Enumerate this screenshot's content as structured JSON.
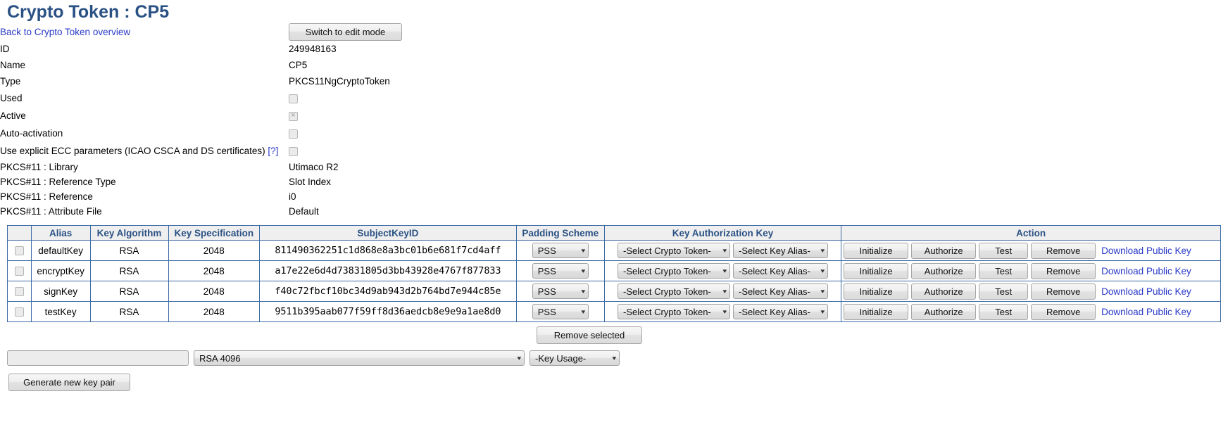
{
  "header": {
    "title": "Crypto Token : CP5",
    "back_link": "Back to Crypto Token overview",
    "switch_button": "Switch to edit mode"
  },
  "details": [
    {
      "label": "ID",
      "value": "249948163",
      "type": "text"
    },
    {
      "label": "Name",
      "value": "CP5",
      "type": "text"
    },
    {
      "label": "Type",
      "value": "PKCS11NgCryptoToken",
      "type": "text"
    },
    {
      "label": "Used",
      "value": "",
      "type": "checkbox",
      "checked": false
    },
    {
      "label": "Active",
      "value": "",
      "type": "checkbox",
      "checked": true
    },
    {
      "label": "Auto-activation",
      "value": "",
      "type": "checkbox",
      "checked": false
    },
    {
      "label": "Use explicit ECC parameters (ICAO CSCA and DS certificates)",
      "value": "",
      "type": "checkbox",
      "checked": false,
      "help": "[?]"
    },
    {
      "label": "PKCS#11 : Library",
      "value": "Utimaco R2",
      "type": "text"
    },
    {
      "label": "PKCS#11 : Reference Type",
      "value": "Slot Index",
      "type": "text"
    },
    {
      "label": "PKCS#11 : Reference",
      "value": "i0",
      "type": "text"
    },
    {
      "label": "PKCS#11 : Attribute File",
      "value": "Default",
      "type": "text"
    }
  ],
  "key_table": {
    "columns": [
      "",
      "Alias",
      "Key Algorithm",
      "Key Specification",
      "SubjectKeyID",
      "Padding Scheme",
      "Key Authorization Key",
      "Action"
    ],
    "rows": [
      {
        "selected": false,
        "alias": "defaultKey",
        "algorithm": "RSA",
        "specification": "2048",
        "subject_key_id": "811490362251c1d868e8a3bc01b6e681f7cd4aff",
        "padding_scheme": "PSS",
        "crypto_token": "-Select Crypto Token-",
        "key_alias": "-Select Key Alias-",
        "actions": [
          "Initialize",
          "Authorize",
          "Test",
          "Remove"
        ],
        "download_link": "Download Public Key"
      },
      {
        "selected": false,
        "alias": "encryptKey",
        "algorithm": "RSA",
        "specification": "2048",
        "subject_key_id": "a17e22e6d4d73831805d3bb43928e4767f877833",
        "padding_scheme": "PSS",
        "crypto_token": "-Select Crypto Token-",
        "key_alias": "-Select Key Alias-",
        "actions": [
          "Initialize",
          "Authorize",
          "Test",
          "Remove"
        ],
        "download_link": "Download Public Key"
      },
      {
        "selected": false,
        "alias": "signKey",
        "algorithm": "RSA",
        "specification": "2048",
        "subject_key_id": "f40c72fbcf10bc34d9ab943d2b764bd7e944c85e",
        "padding_scheme": "PSS",
        "crypto_token": "-Select Crypto Token-",
        "key_alias": "-Select Key Alias-",
        "actions": [
          "Initialize",
          "Authorize",
          "Test",
          "Remove"
        ],
        "download_link": "Download Public Key"
      },
      {
        "selected": false,
        "alias": "testKey",
        "algorithm": "RSA",
        "specification": "2048",
        "subject_key_id": "9511b395aab077f59ff8d36aedcb8e9e9a1ae8d0",
        "padding_scheme": "PSS",
        "crypto_token": "-Select Crypto Token-",
        "key_alias": "-Select Key Alias-",
        "actions": [
          "Initialize",
          "Authorize",
          "Test",
          "Remove"
        ],
        "download_link": "Download Public Key"
      }
    ]
  },
  "footer": {
    "remove_selected_button": "Remove selected",
    "new_alias_value": "",
    "new_alias_placeholder": "",
    "key_algorithm_selected": "RSA 4096",
    "key_usage_selected": "-Key Usage-",
    "generate_button": "Generate new key pair"
  },
  "colors": {
    "title": "#2a5184",
    "link": "#2a3ac8",
    "table_border": "#3b6aa5",
    "header_bg": "#efefef"
  }
}
